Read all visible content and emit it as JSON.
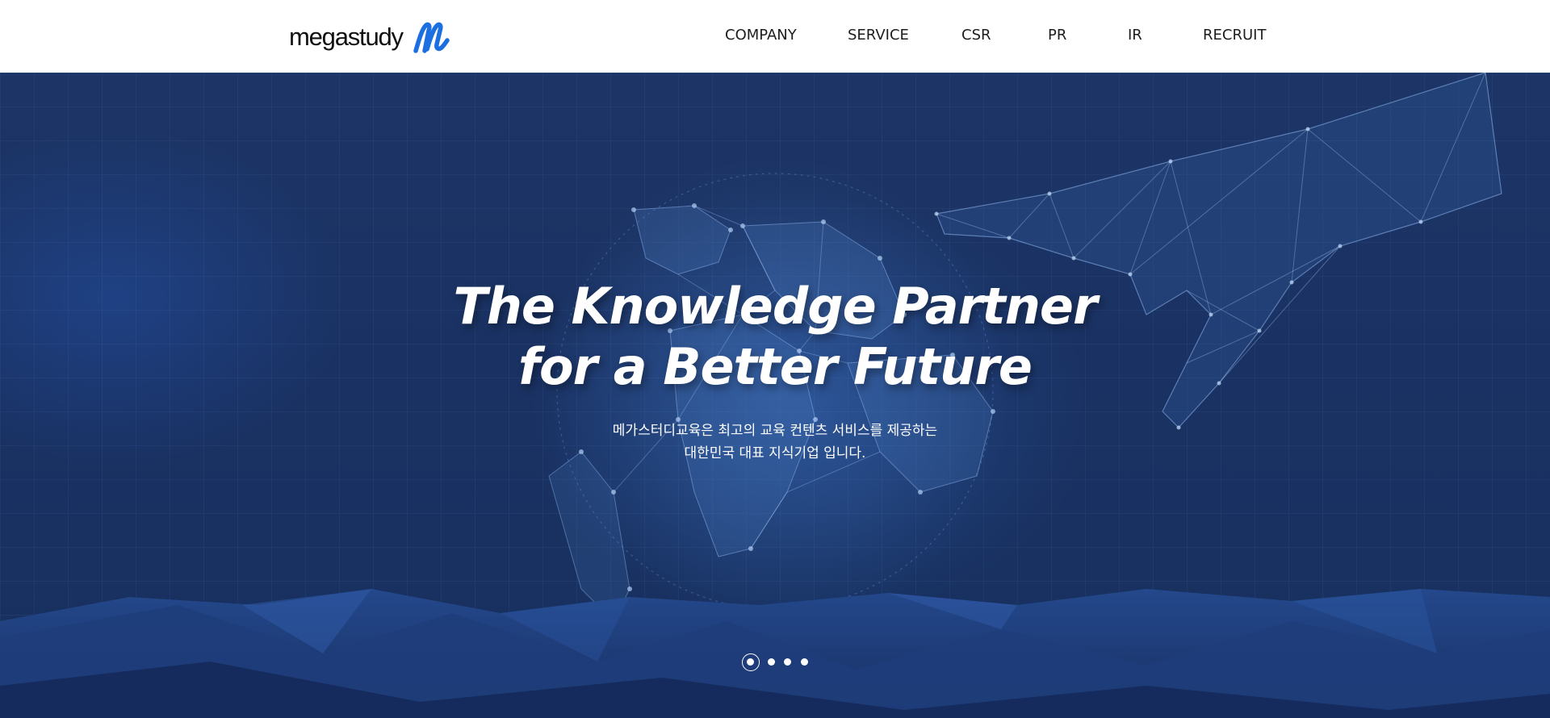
{
  "header": {
    "logo": {
      "text": "megastudy",
      "mark_icon": "megastudy-m-logo-icon",
      "mark_color": "#1c6fe0"
    },
    "nav": [
      {
        "label": "COMPANY"
      },
      {
        "label": "SERVICE"
      },
      {
        "label": "CSR"
      },
      {
        "label": "PR"
      },
      {
        "label": "IR"
      },
      {
        "label": "RECRUIT"
      }
    ]
  },
  "hero": {
    "title_line1": "The Knowledge Partner",
    "title_line2": "for a Better Future",
    "subtitle_line1": "메가스터디교육은 최고의 교육 컨텐츠 서비스를 제공하는",
    "subtitle_line2": "대한민국 대표 지식기업 입니다.",
    "background_color": "#1a3263",
    "slider": {
      "total": 4,
      "active_index": 1
    }
  },
  "colors": {
    "header_bg": "#ffffff",
    "nav_text": "#1d1d1d",
    "hero_text": "#ffffff",
    "accent": "#1c6fe0"
  }
}
